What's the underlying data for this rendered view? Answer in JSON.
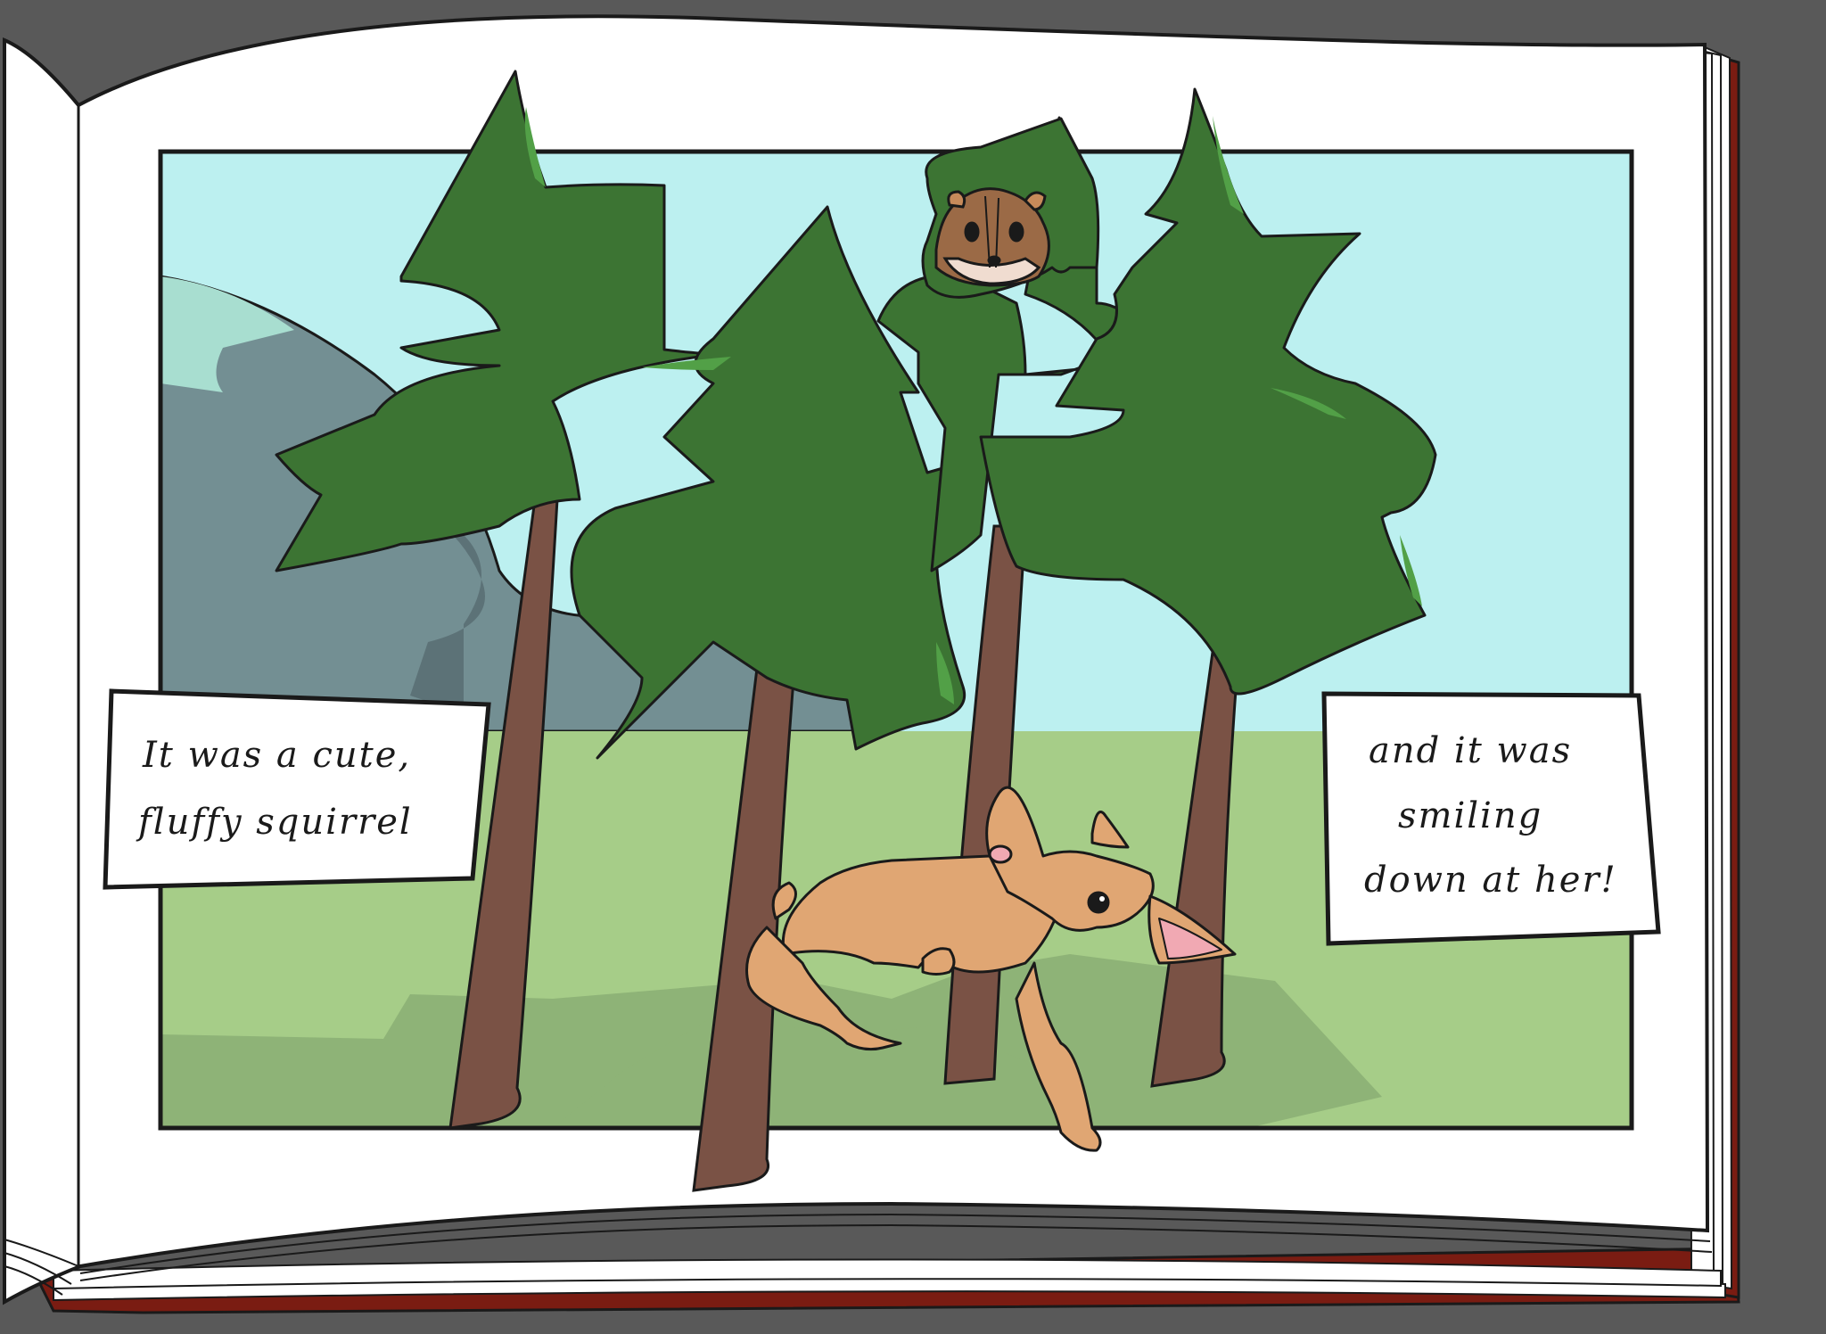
{
  "scene": {
    "kind": "storybook-illustration",
    "colors": {
      "background": "#595959",
      "book_cover": "#7a1c12",
      "page": "#ffffff",
      "sky": "#bcf0f0",
      "mountain": "#738f93",
      "mountain_shadow": "#5c7277",
      "grass": "#a6cd88",
      "grass_shadow": "#8eb377",
      "foliage": "#3c7433",
      "foliage_highlight": "#52a047",
      "trunk": "#7a5245",
      "dog_fur": "#e0a673",
      "squirrel_fur": "#9b6a46"
    }
  },
  "captions": {
    "left": {
      "lines": [
        "It was a cute,",
        "fluffy squirrel"
      ]
    },
    "right": {
      "lines": [
        "and it was",
        "smiling",
        "down at her!"
      ]
    }
  }
}
